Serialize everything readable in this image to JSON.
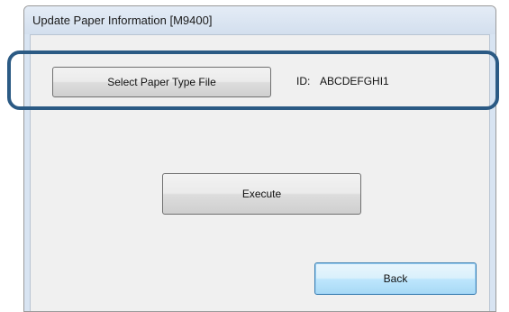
{
  "window": {
    "title": "Update Paper Information [M9400]"
  },
  "paper": {
    "select_button_label": "Select Paper Type File",
    "id_label": "ID:",
    "id_value": "ABCDEFGHI1"
  },
  "actions": {
    "execute_label": "Execute",
    "back_label": "Back"
  },
  "colors": {
    "highlight_frame": "#2b5a84",
    "title_bar": "#d8e4f2",
    "default_button_border": "#3c7fb1"
  }
}
